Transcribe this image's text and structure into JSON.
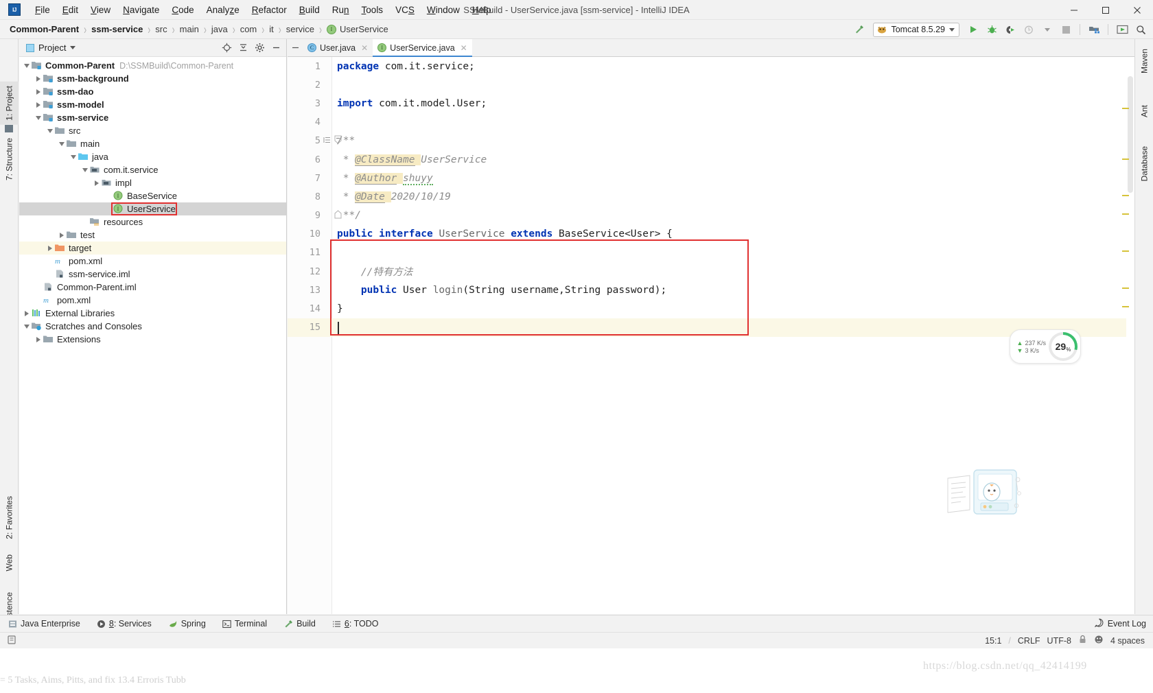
{
  "window": {
    "title": "SSMBuild - UserService.java [ssm-service] - IntelliJ IDEA",
    "logo": "intellij-idea-logo",
    "controls": {
      "minimize": "minimize-icon",
      "maximize": "maximize-icon",
      "close": "close-icon"
    }
  },
  "menubar": {
    "items": [
      {
        "label": "File",
        "mnemonic": "F"
      },
      {
        "label": "Edit",
        "mnemonic": "E"
      },
      {
        "label": "View",
        "mnemonic": "V"
      },
      {
        "label": "Navigate",
        "mnemonic": "N"
      },
      {
        "label": "Code",
        "mnemonic": "C"
      },
      {
        "label": "Analyze",
        "mnemonic": "z"
      },
      {
        "label": "Refactor",
        "mnemonic": "R"
      },
      {
        "label": "Build",
        "mnemonic": "B"
      },
      {
        "label": "Run",
        "mnemonic": "n"
      },
      {
        "label": "Tools",
        "mnemonic": "T"
      },
      {
        "label": "VCS",
        "mnemonic": "S"
      },
      {
        "label": "Window",
        "mnemonic": "W"
      },
      {
        "label": "Help",
        "mnemonic": "H"
      }
    ]
  },
  "breadcrumb": {
    "items": [
      {
        "label": "Common-Parent",
        "bold": true
      },
      {
        "label": "ssm-service",
        "bold": true
      },
      {
        "label": "src",
        "bold": false
      },
      {
        "label": "main",
        "bold": false
      },
      {
        "label": "java",
        "bold": false
      },
      {
        "label": "com",
        "bold": false
      },
      {
        "label": "it",
        "bold": false
      },
      {
        "label": "service",
        "bold": false
      },
      {
        "label": "UserService",
        "bold": false,
        "icon": "interface-icon"
      }
    ]
  },
  "toolbar": {
    "build_label": "build-hammer-icon",
    "run_config": {
      "label": "Tomcat 8.5.29",
      "icon": "tomcat-icon",
      "dropdown": "chevron-down-icon"
    },
    "run_button": "run-icon",
    "debug_button": "debug-icon",
    "run_coverage_button": "run-with-coverage-icon",
    "profile_button": "profile-icon",
    "stop_button": "stop-icon",
    "project_structure_button": "project-structure-icon",
    "update_app_button": "update-running-application-icon",
    "search_button": "search-everywhere-icon"
  },
  "left_stripe": {
    "tabs": [
      {
        "label": "1: Project",
        "selected": true,
        "icon": "project-icon"
      },
      {
        "label": "7: Structure",
        "selected": false,
        "icon": "structure-icon"
      },
      {
        "label": "2: Favorites",
        "selected": false,
        "icon": "star-icon"
      },
      {
        "label": "Web",
        "selected": false,
        "icon": "web-icon"
      },
      {
        "label": "Persistence",
        "selected": false,
        "icon": "persistence-icon"
      }
    ]
  },
  "right_stripe": {
    "tabs": [
      {
        "label": "Maven",
        "icon": "maven-icon"
      },
      {
        "label": "Ant",
        "icon": "ant-icon"
      },
      {
        "label": "Database",
        "icon": "database-icon"
      }
    ]
  },
  "project_panel": {
    "title": "Project",
    "title_dropdown": "chevron-down-icon",
    "actions": [
      "locate-icon",
      "collapse-all-icon",
      "settings-gear-icon",
      "hide-icon"
    ],
    "tree": [
      {
        "indent": 0,
        "arrow": "open",
        "icon": "module-root",
        "label": "Common-Parent",
        "bold": true,
        "path": "D:\\SSMBuild\\Common-Parent",
        "state": "normal"
      },
      {
        "indent": 1,
        "arrow": "closed",
        "icon": "module-root",
        "label": "ssm-background",
        "bold": true,
        "path": "",
        "state": "normal"
      },
      {
        "indent": 1,
        "arrow": "closed",
        "icon": "module-root",
        "label": "ssm-dao",
        "bold": true,
        "path": "",
        "state": "normal"
      },
      {
        "indent": 1,
        "arrow": "closed",
        "icon": "module-root",
        "label": "ssm-model",
        "bold": true,
        "path": "",
        "state": "normal"
      },
      {
        "indent": 1,
        "arrow": "open",
        "icon": "module-root",
        "label": "ssm-service",
        "bold": true,
        "path": "",
        "state": "normal"
      },
      {
        "indent": 2,
        "arrow": "open",
        "icon": "folder-gray",
        "label": "src",
        "bold": false,
        "path": "",
        "state": "normal"
      },
      {
        "indent": 3,
        "arrow": "open",
        "icon": "folder-gray",
        "label": "main",
        "bold": false,
        "path": "",
        "state": "normal"
      },
      {
        "indent": 4,
        "arrow": "open",
        "icon": "folder-source",
        "label": "java",
        "bold": false,
        "path": "",
        "state": "normal"
      },
      {
        "indent": 5,
        "arrow": "open",
        "icon": "package-icon",
        "label": "com.it.service",
        "bold": false,
        "path": "",
        "state": "normal"
      },
      {
        "indent": 6,
        "arrow": "closed",
        "icon": "package-icon",
        "label": "impl",
        "bold": false,
        "path": "",
        "state": "normal"
      },
      {
        "indent": 7,
        "arrow": "none",
        "icon": "interface-icon",
        "label": "BaseService",
        "bold": false,
        "path": "",
        "state": "normal"
      },
      {
        "indent": 7,
        "arrow": "none",
        "icon": "interface-icon",
        "label": "UserService",
        "bold": false,
        "path": "",
        "state": "selected-highlighted"
      },
      {
        "indent": 5,
        "arrow": "none",
        "icon": "folder-resources",
        "label": "resources",
        "bold": false,
        "path": "",
        "state": "normal"
      },
      {
        "indent": 3,
        "arrow": "closed",
        "icon": "folder-gray",
        "label": "test",
        "bold": false,
        "path": "",
        "state": "normal"
      },
      {
        "indent": 2,
        "arrow": "closed",
        "icon": "folder-target",
        "label": "target",
        "bold": false,
        "path": "",
        "state": "yellow"
      },
      {
        "indent": 2,
        "arrow": "none",
        "icon": "maven-file",
        "label": "pom.xml",
        "bold": false,
        "path": "",
        "state": "normal"
      },
      {
        "indent": 2,
        "arrow": "none",
        "icon": "iml-file",
        "label": "ssm-service.iml",
        "bold": false,
        "path": "",
        "state": "normal"
      },
      {
        "indent": 1,
        "arrow": "none",
        "icon": "iml-file",
        "label": "Common-Parent.iml",
        "bold": false,
        "path": "",
        "state": "normal"
      },
      {
        "indent": 1,
        "arrow": "none",
        "icon": "maven-file",
        "label": "pom.xml",
        "bold": false,
        "path": "",
        "state": "normal"
      },
      {
        "indent": 0,
        "arrow": "closed",
        "icon": "libraries-icon",
        "label": "External Libraries",
        "bold": false,
        "path": "",
        "state": "normal"
      },
      {
        "indent": 0,
        "arrow": "open",
        "icon": "scratches-icon",
        "label": "Scratches and Consoles",
        "bold": false,
        "path": "",
        "state": "normal"
      },
      {
        "indent": 1,
        "arrow": "closed",
        "icon": "folder-gray",
        "label": "Extensions",
        "bold": false,
        "path": "",
        "state": "normal"
      }
    ]
  },
  "editor": {
    "tabs": [
      {
        "label": "User.java",
        "icon": "class-icon",
        "active": false,
        "close": "close-icon"
      },
      {
        "label": "UserService.java",
        "icon": "interface-icon",
        "active": true,
        "close": "close-icon"
      }
    ],
    "hide_tabs_button": "hide-icon",
    "lines": [
      {
        "num": "1",
        "highlight": false,
        "fold": "",
        "segments": [
          {
            "t": "package",
            "c": "kw"
          },
          {
            "t": " com.it.service;",
            "c": "pl"
          }
        ]
      },
      {
        "num": "2",
        "highlight": false,
        "fold": "",
        "segments": []
      },
      {
        "num": "3",
        "highlight": false,
        "fold": "",
        "segments": [
          {
            "t": "import",
            "c": "kw"
          },
          {
            "t": " com.it.model.User;",
            "c": "pl"
          }
        ]
      },
      {
        "num": "4",
        "highlight": false,
        "fold": "",
        "segments": []
      },
      {
        "num": "5",
        "highlight": false,
        "fold": "minus",
        "segments": [
          {
            "t": "/**",
            "c": "cm"
          }
        ]
      },
      {
        "num": "6",
        "highlight": false,
        "fold": "",
        "segments": [
          {
            "t": " * ",
            "c": "cm"
          },
          {
            "t": "@ClassName",
            "c": "anno"
          },
          {
            "t": " ",
            "c": "annob"
          },
          {
            "t": "UserService",
            "c": "cm"
          }
        ]
      },
      {
        "num": "7",
        "highlight": false,
        "fold": "",
        "segments": [
          {
            "t": " * ",
            "c": "cm"
          },
          {
            "t": "@Author",
            "c": "anno"
          },
          {
            "t": " ",
            "c": "annob"
          },
          {
            "t": "shuyy",
            "c": "cm sq"
          }
        ]
      },
      {
        "num": "8",
        "highlight": false,
        "fold": "",
        "segments": [
          {
            "t": " * ",
            "c": "cm"
          },
          {
            "t": "@Date",
            "c": "anno"
          },
          {
            "t": " ",
            "c": "annob"
          },
          {
            "t": "2020/10/19",
            "c": "cm"
          }
        ]
      },
      {
        "num": "9",
        "highlight": false,
        "fold": "end",
        "segments": [
          {
            "t": " **/",
            "c": "cm"
          }
        ]
      },
      {
        "num": "10",
        "highlight": false,
        "fold": "",
        "segments": [
          {
            "t": "public",
            "c": "kw"
          },
          {
            "t": " ",
            "c": "pl"
          },
          {
            "t": "interface",
            "c": "kw"
          },
          {
            "t": " ",
            "c": "pl"
          },
          {
            "t": "UserService",
            "c": "ty"
          },
          {
            "t": " ",
            "c": "pl"
          },
          {
            "t": "extends",
            "c": "kw"
          },
          {
            "t": " ",
            "c": "pl"
          },
          {
            "t": "BaseService<User> {",
            "c": "pl"
          }
        ]
      },
      {
        "num": "11",
        "highlight": false,
        "fold": "",
        "segments": []
      },
      {
        "num": "12",
        "highlight": false,
        "fold": "",
        "segments": [
          {
            "t": "    //特有方法",
            "c": "cm"
          }
        ]
      },
      {
        "num": "13",
        "highlight": false,
        "fold": "",
        "segments": [
          {
            "t": "    ",
            "c": "pl"
          },
          {
            "t": "public",
            "c": "kw"
          },
          {
            "t": " ",
            "c": "pl"
          },
          {
            "t": "User",
            "c": "pl"
          },
          {
            "t": " ",
            "c": "pl"
          },
          {
            "t": "login",
            "c": "ty"
          },
          {
            "t": "(",
            "c": "pl"
          },
          {
            "t": "String",
            "c": "pl"
          },
          {
            "t": " username,",
            "c": "pl"
          },
          {
            "t": "String",
            "c": "pl"
          },
          {
            "t": " password);",
            "c": "pl"
          }
        ]
      },
      {
        "num": "14",
        "highlight": false,
        "fold": "",
        "segments": [
          {
            "t": "}",
            "c": "pl"
          }
        ]
      },
      {
        "num": "15",
        "highlight": true,
        "fold": "",
        "segments": []
      }
    ],
    "code_highlight_box": true
  },
  "net_widget": {
    "upload": "237 K/s",
    "download": "3  K/s",
    "upload_icon": "arrow-up-icon",
    "download_icon": "arrow-down-icon",
    "percent": "29",
    "percent_symbol": "%"
  },
  "bottom_toolbar": {
    "items": [
      {
        "label": "Java Enterprise",
        "icon": "java-enterprise-icon",
        "mnemonic": ""
      },
      {
        "label": "8: Services",
        "icon": "services-icon",
        "mnemonic": "8"
      },
      {
        "label": "Spring",
        "icon": "spring-icon",
        "mnemonic": ""
      },
      {
        "label": "Terminal",
        "icon": "terminal-icon",
        "mnemonic": ""
      },
      {
        "label": "Build",
        "icon": "build-icon",
        "mnemonic": ""
      },
      {
        "label": "6: TODO",
        "icon": "todo-icon",
        "mnemonic": "6"
      }
    ],
    "event_log": {
      "label": "Event Log",
      "icon": "event-log-icon"
    }
  },
  "statusbar": {
    "memory_icon": "memory-indicator-icon",
    "caret_position": "15:1",
    "line_separator": "CRLF",
    "encoding": "UTF-8",
    "lock_icon": "read-only-lock-icon",
    "git_icon": "git-branch-icon",
    "indent": "4 spaces",
    "separator": "/"
  },
  "watermarks": {
    "right": "https://blog.csdn.net/qq_42414199",
    "bottom": "= 5 Tasks, Aims, Pitts, and fix 13.4 Erroris Tubb"
  },
  "colors": {
    "accent_blue": "#3d86d0",
    "keyword_blue": "#0033b3",
    "red_box": "#e03030",
    "green_interface": "#94ca7d",
    "highlight_yellow": "#fbf8e6",
    "annotation_bg": "#f7ebc3",
    "selection_gray": "#d4d4d4",
    "ring_green": "#3bbf6e"
  }
}
